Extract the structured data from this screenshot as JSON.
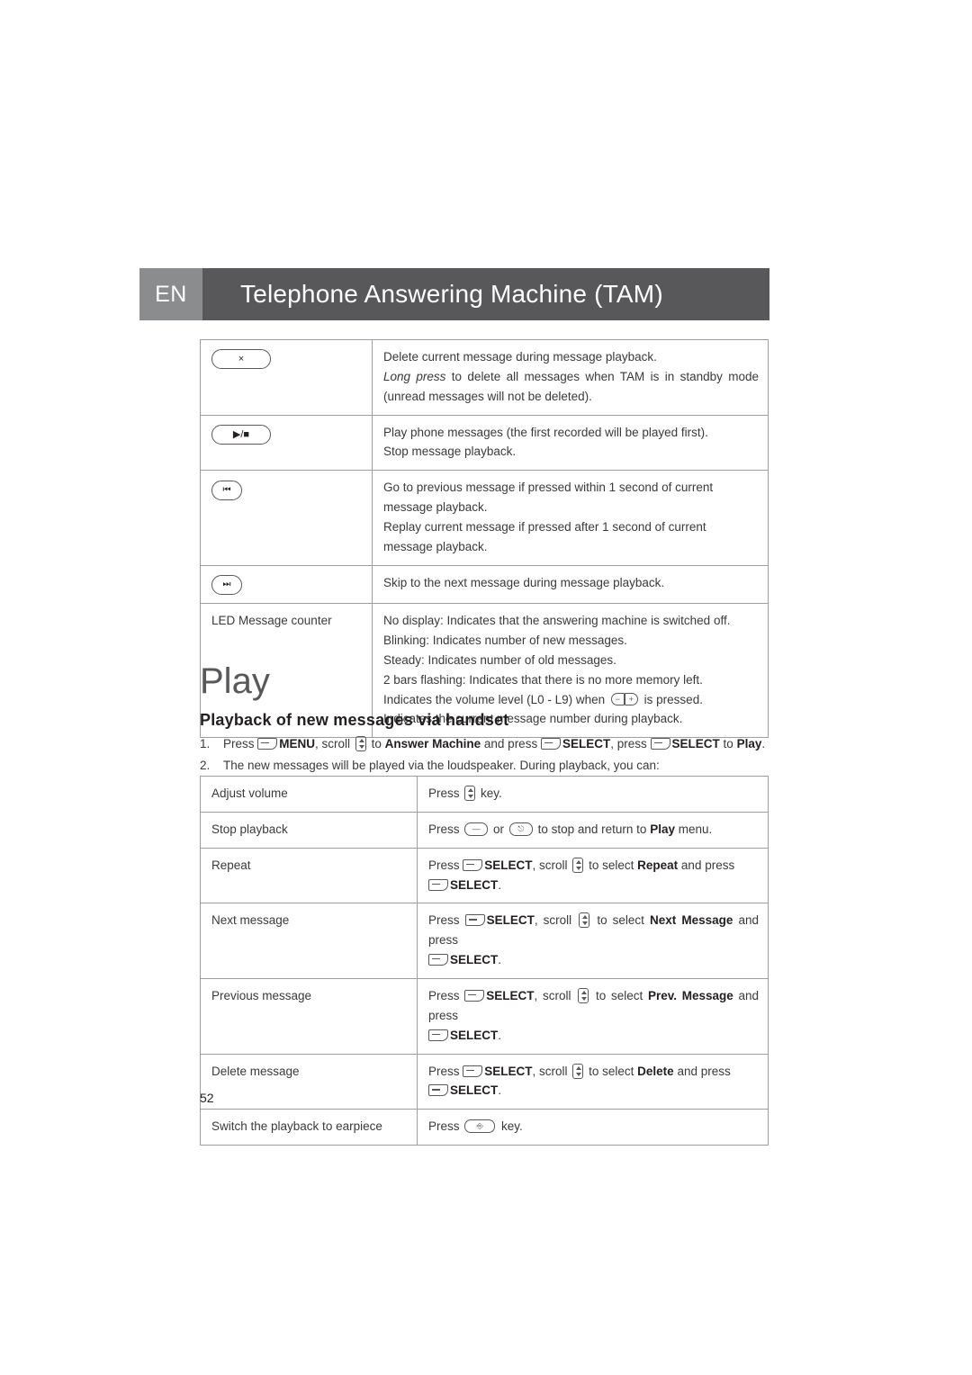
{
  "header": {
    "lang": "EN",
    "title": "Telephone Answering Machine (TAM)"
  },
  "key_table": {
    "rows": [
      {
        "key_icon": "delete-key",
        "key_glyph": "×",
        "lines": [
          "Delete current message during message playback.",
          "Long press to delete all messages when TAM is in standby mode (unread messages will not be deleted)."
        ]
      },
      {
        "key_icon": "play-stop-key",
        "key_glyph": "▶/■",
        "lines": [
          "Play phone messages (the first recorded will be played first).",
          "Stop message playback."
        ]
      },
      {
        "key_icon": "previous-key",
        "key_glyph": "⏮",
        "lines": [
          "Go to previous message if pressed within 1 second of current message playback.",
          "Replay current message if pressed after 1 second of current message playback."
        ]
      },
      {
        "key_icon": "next-key",
        "key_glyph": "⏭",
        "lines": [
          "Skip to the next message during message playback."
        ]
      },
      {
        "key_icon": "",
        "key_glyph": "",
        "label": "LED Message counter",
        "lines": [
          "No display: Indicates that the answering machine is switched off.",
          "Blinking: Indicates number of new messages.",
          "Steady: Indicates number of old messages.",
          "2 bars flashing: Indicates that there is no more memory left.",
          "Indicates the volume level (L0 - L9) when  is pressed.",
          "Indicates the current message number during playback."
        ],
        "volume_line_pre": "Indicates the volume level (L0 - L9) when",
        "volume_line_post": "is pressed."
      }
    ]
  },
  "play": {
    "title": "Play",
    "subtitle": "Playback of new messages via handset",
    "step1": {
      "num": "1.",
      "p1": "Press",
      "menu": "MENU",
      "p2": ", scroll",
      "p3": "to",
      "answer_machine": "Answer Machine",
      "p4": "and press",
      "select1": "SELECT",
      "p5": ", press",
      "select2": "SELECT",
      "p6": "to",
      "play_word": "Play",
      "p7": "."
    },
    "step2": {
      "num": "2.",
      "text": "The new messages will be played via the loudspeaker. During playback, you can:"
    }
  },
  "play_table": {
    "rows": [
      {
        "label": "Adjust volume",
        "type": "volume",
        "pre": "Press",
        "post": "key."
      },
      {
        "label": "Stop playback",
        "type": "stop",
        "pre": "Press",
        "mid": "or",
        "post": "to stop and return to",
        "menu_word": "Play",
        "post2": "menu."
      },
      {
        "label": "Repeat",
        "type": "select",
        "pre": "Press",
        "select": "SELECT",
        "mid": ", scroll",
        "mid2": "to select",
        "option": "Repeat",
        "mid3": "and press",
        "select2": "SELECT",
        "end": "."
      },
      {
        "label": "Next message",
        "type": "select",
        "pre": "Press",
        "select": "SELECT",
        "mid": ", scroll",
        "mid2": "to select",
        "option": "Next Message",
        "mid3": "and press",
        "select2": "SELECT",
        "end": "."
      },
      {
        "label": "Previous message",
        "type": "select",
        "pre": "Press",
        "select": "SELECT",
        "mid": ", scroll",
        "mid2": "to select",
        "option": "Prev. Message",
        "mid3": "and press",
        "select2": "SELECT",
        "end": "."
      },
      {
        "label": "Delete message",
        "type": "select",
        "pre": "Press",
        "select": "SELECT",
        "mid": ", scroll",
        "mid2": "to select",
        "option": "Delete",
        "mid3": "and press",
        "select2": "SELECT",
        "end": "."
      },
      {
        "label": "Switch the playback to earpiece",
        "type": "earpiece",
        "pre": "Press",
        "post": "key."
      }
    ]
  },
  "page_number": "52"
}
